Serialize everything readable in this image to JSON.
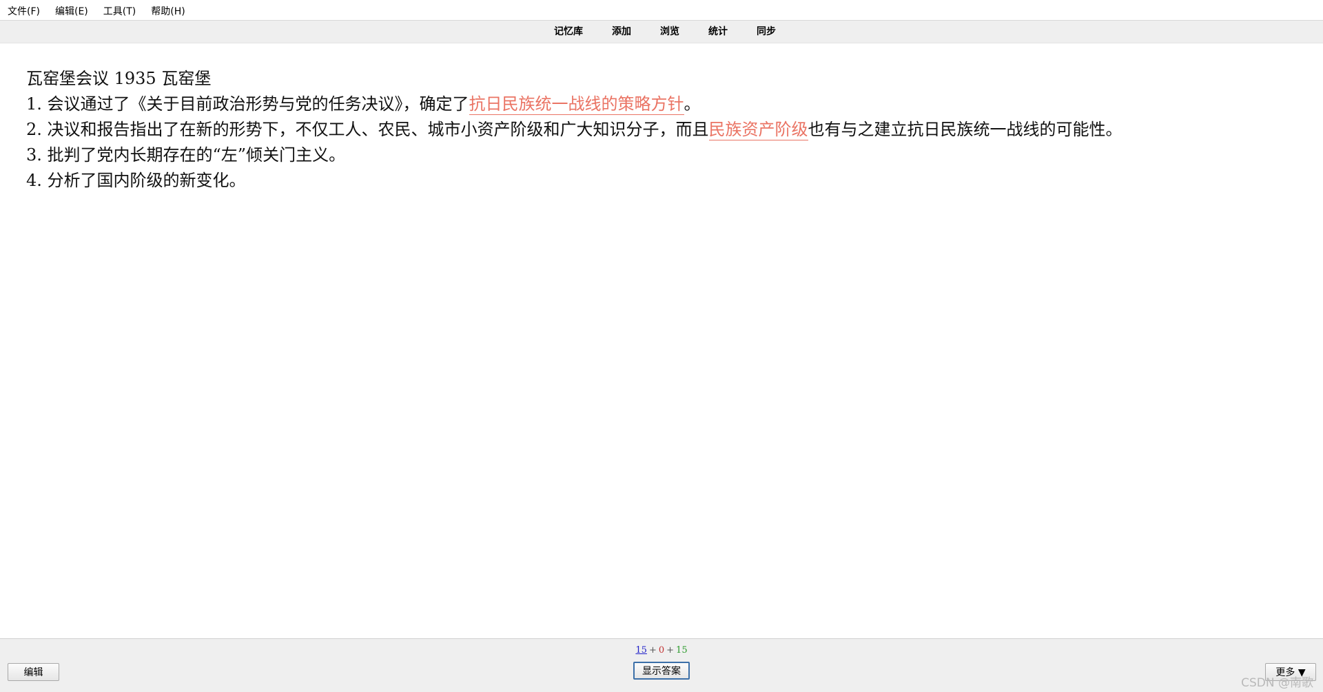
{
  "menu": [
    "文件(F)",
    "编辑(E)",
    "工具(T)",
    "帮助(H)"
  ],
  "toolbar": [
    "记忆库",
    "添加",
    "浏览",
    "统计",
    "同步"
  ],
  "card": {
    "line0": "瓦窑堡会议 1935 瓦窑堡",
    "line1_pre": "1. 会议通过了《关于目前政治形势与党的任务决议》，确定了",
    "line1_cloze": "抗日民族统一战线的策略方针",
    "line1_post": "。",
    "line2_pre": "2. 决议和报告指出了在新的形势下，不仅工人、农民、城市小资产阶级和广大知识分子，而且",
    "line2_cloze": "民族资产阶级",
    "line2_post": "也有与之建立抗日民族统一战线的可能性。",
    "line3": "3. 批判了党内长期存在的“左”倾关门主义。",
    "line4": "4. 分析了国内阶级的新变化。",
    "cloze_color": "#ea7363"
  },
  "counts": {
    "new": "15",
    "learn": "0",
    "review": "15",
    "sep": "+"
  },
  "buttons": {
    "edit": "编辑",
    "show_answer": "显示答案",
    "more": "更多 ▼"
  },
  "watermark": "CSDN @南歌"
}
